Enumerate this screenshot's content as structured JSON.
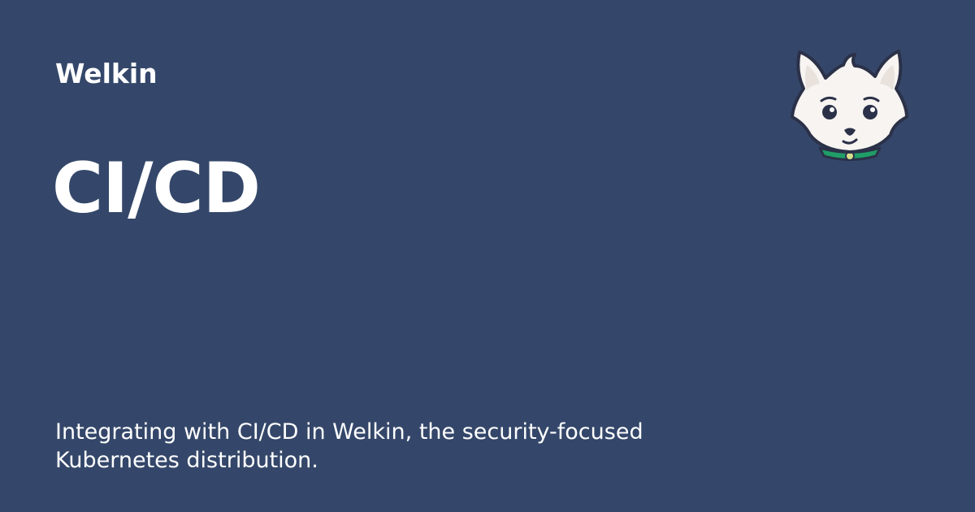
{
  "brand": {
    "name": "Welkin"
  },
  "page": {
    "title": "CI/CD",
    "description": "Integrating with CI/CD in Welkin, the security-focused Kubernetes distribution."
  },
  "mascot": {
    "icon": "fox-mascot-icon"
  },
  "colors": {
    "background": "#34476a",
    "text": "#ffffff",
    "mascot_face": "#f7f4f1",
    "mascot_outline": "#2b3148",
    "mascot_collar": "#1f9e67"
  }
}
